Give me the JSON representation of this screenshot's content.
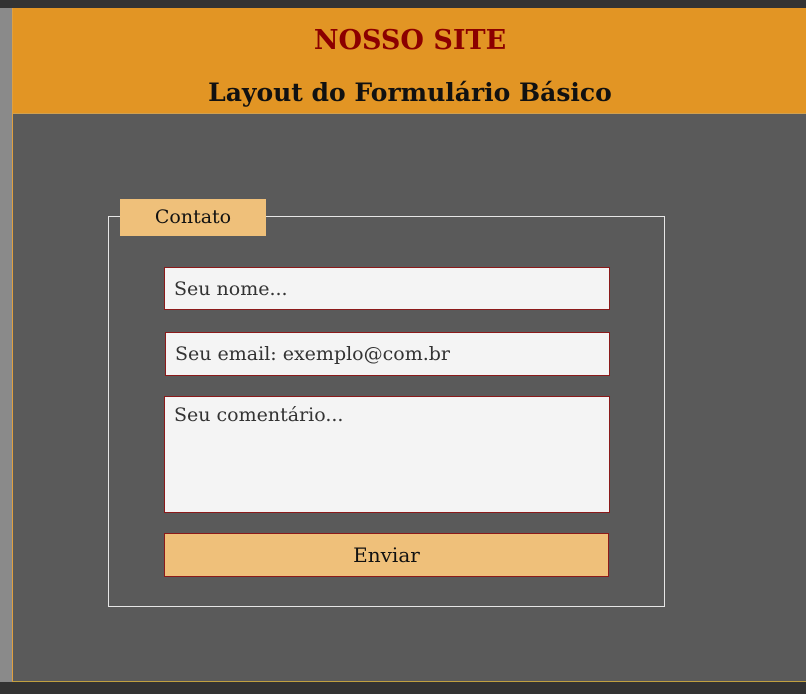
{
  "header": {
    "site_title": "NOSSO SITE",
    "subtitle": "Layout do Formulário Básico"
  },
  "form": {
    "legend": "Contato",
    "name_placeholder": "Seu nome...",
    "email_placeholder": "Seu email: exemplo@com.br",
    "comment_placeholder": "Seu comentário...",
    "submit_label": "Enviar"
  },
  "colors": {
    "header_bg": "#e29524",
    "title_color": "#8b0000",
    "page_bg": "#5a5a5a",
    "legend_bg": "#efc07a",
    "button_bg": "#efc07a",
    "field_border": "#8b1a1a",
    "field_bg": "#f4f4f4"
  }
}
